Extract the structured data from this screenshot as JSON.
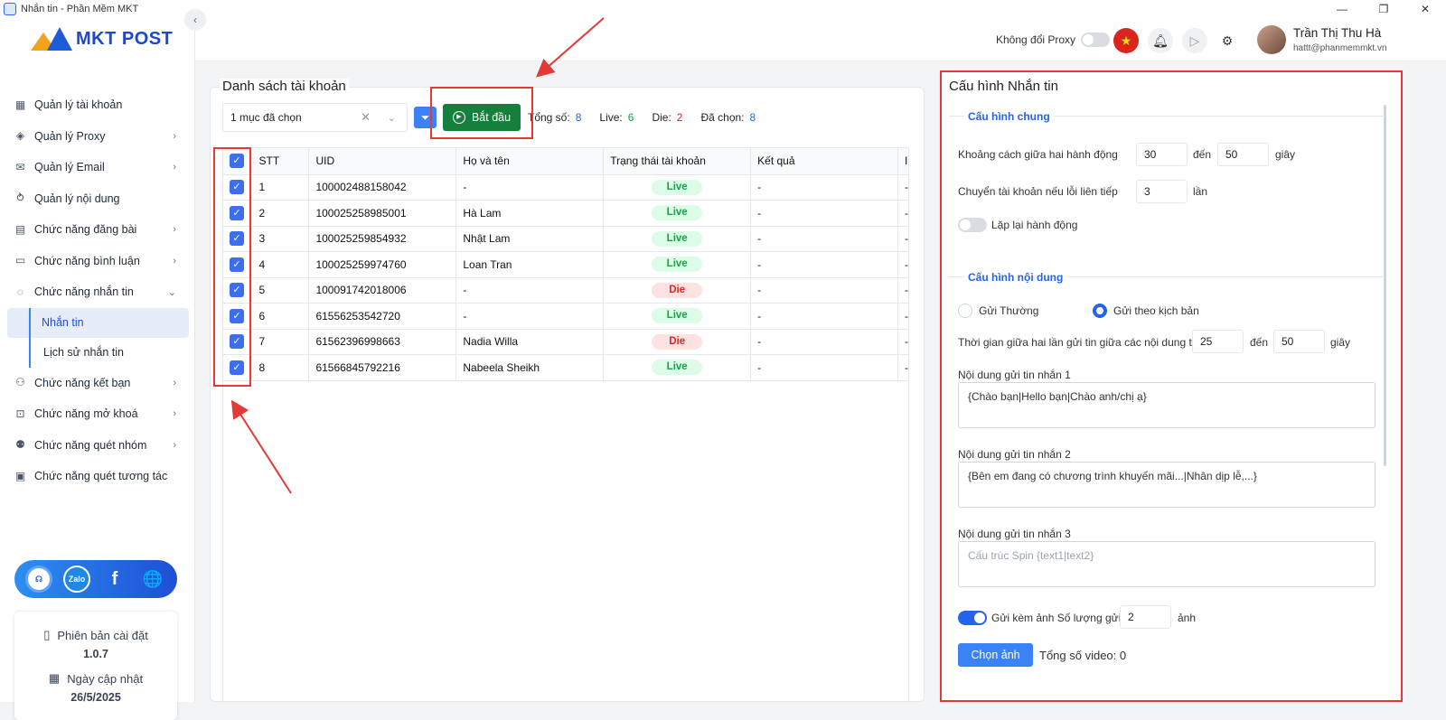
{
  "window": {
    "title": "Nhắn tin - Phần Mềm MKT",
    "controls": [
      "—",
      "❐",
      "✕"
    ]
  },
  "logo": {
    "text": "MKT POST"
  },
  "sidebar": {
    "items": [
      {
        "label": "Quản lý tài khoản",
        "icon": "grid-icon",
        "chevron": ""
      },
      {
        "label": "Quản lý Proxy",
        "icon": "layers-icon",
        "chevron": "›"
      },
      {
        "label": "Quản lý Email",
        "icon": "mail-icon",
        "chevron": "›"
      },
      {
        "label": "Quản lý nội dung",
        "icon": "content-icon",
        "chevron": ""
      },
      {
        "label": "Chức năng đăng bài",
        "icon": "post-icon",
        "chevron": "›"
      },
      {
        "label": "Chức năng bình luận",
        "icon": "comment-icon",
        "chevron": "›"
      },
      {
        "label": "Chức năng nhắn tin",
        "icon": "message-icon",
        "chevron": "⌄"
      },
      {
        "label": "Nhắn tin",
        "sub": true
      },
      {
        "label": "Lịch sử nhắn tin",
        "sub": true
      },
      {
        "label": "Chức năng kết bạn",
        "icon": "add-friend-icon",
        "chevron": "›"
      },
      {
        "label": "Chức năng mở khoá",
        "icon": "unlock-icon",
        "chevron": "›"
      },
      {
        "label": "Chức năng quét nhóm",
        "icon": "group-icon",
        "chevron": "›"
      },
      {
        "label": "Chức năng quét tương tác",
        "icon": "scan-icon",
        "chevron": ""
      }
    ],
    "social": {
      "zalo": "Zalo",
      "facebook": "f"
    },
    "version_label": "Phiên bản cài đặt",
    "version": "1.0.7",
    "update_label": "Ngày cập nhật",
    "update_date": "26/5/2025"
  },
  "topbar": {
    "proxy_label": "Không đổi Proxy",
    "user_name": "Trần Thị Thu Hà",
    "user_email": "hattt@phanmemmkt.vn"
  },
  "accounts": {
    "title": "Danh sách tài khoản",
    "filter_value": "1 mục đã chọn",
    "start_label": "Bắt đầu",
    "stats": {
      "total_label": "Tổng số:",
      "total": "8",
      "live_label": "Live:",
      "live": "6",
      "die_label": "Die:",
      "die": "2",
      "selected_label": "Đã chọn:",
      "selected": "8"
    },
    "columns": [
      "STT",
      "UID",
      "Họ và tên",
      "Trạng thái tài khoản",
      "Kết quả",
      "I"
    ],
    "rows": [
      {
        "stt": "1",
        "uid": "100002488158042",
        "name": "-",
        "status": "Live",
        "result": "-",
        "extra": "-"
      },
      {
        "stt": "2",
        "uid": "100025258985001",
        "name": "Hà Lam",
        "status": "Live",
        "result": "-",
        "extra": "-"
      },
      {
        "stt": "3",
        "uid": "100025259854932",
        "name": "Nhật Lam",
        "status": "Live",
        "result": "-",
        "extra": "-"
      },
      {
        "stt": "4",
        "uid": "100025259974760",
        "name": "Loan Tran",
        "status": "Live",
        "result": "-",
        "extra": "-"
      },
      {
        "stt": "5",
        "uid": "100091742018006",
        "name": "-",
        "status": "Die",
        "result": "-",
        "extra": "-"
      },
      {
        "stt": "6",
        "uid": "61556253542720",
        "name": "-",
        "status": "Live",
        "result": "-",
        "extra": "-"
      },
      {
        "stt": "7",
        "uid": "61562396998663",
        "name": "Nadia Willa",
        "status": "Die",
        "result": "-",
        "extra": "-"
      },
      {
        "stt": "8",
        "uid": "61566845792216",
        "name": "Nabeela Sheikh",
        "status": "Live",
        "result": "-",
        "extra": "-"
      }
    ]
  },
  "config": {
    "title": "Cấu hình Nhắn tin",
    "general_title": "Cấu hình chung",
    "delay_label": "Khoảng cách giữa hai hành động",
    "delay_from": "30",
    "to_label": "đến",
    "delay_to": "50",
    "seconds_label": "giây",
    "switch_label": "Chuyển tài khoản nếu lỗi liên tiếp",
    "switch_value": "3",
    "times_label": "lần",
    "repeat_label": "Lặp lại hành động",
    "content_title": "Cấu hình nội dung",
    "radio_normal": "Gửi Thường",
    "radio_script": "Gửi theo kịch bản",
    "between_label": "Thời gian giữa hai lần gửi tin giữa các nội dung từ",
    "between_from": "25",
    "between_to_label": "đến",
    "between_to": "50",
    "between_unit": "giây",
    "msg1_label": "Nội dung gửi tin nhắn 1",
    "msg1_value": "{Chào bạn|Hello bạn|Chào anh/chị ạ}",
    "msg2_label": "Nội dung gửi tin nhắn 2",
    "msg2_value": "{Bên em đang có chương trình khuyến mãi...|Nhân dịp lễ,...}",
    "msg3_label": "Nội dung gửi tin nhắn 3",
    "msg3_placeholder": "Cấu trúc Spin {text1|text2}",
    "attach_label": "Gửi kèm ảnh Số lượng gửi",
    "attach_count": "2",
    "attach_unit": "ảnh",
    "choose_image": "Chọn ảnh",
    "video_total": "Tổng số video: 0"
  }
}
